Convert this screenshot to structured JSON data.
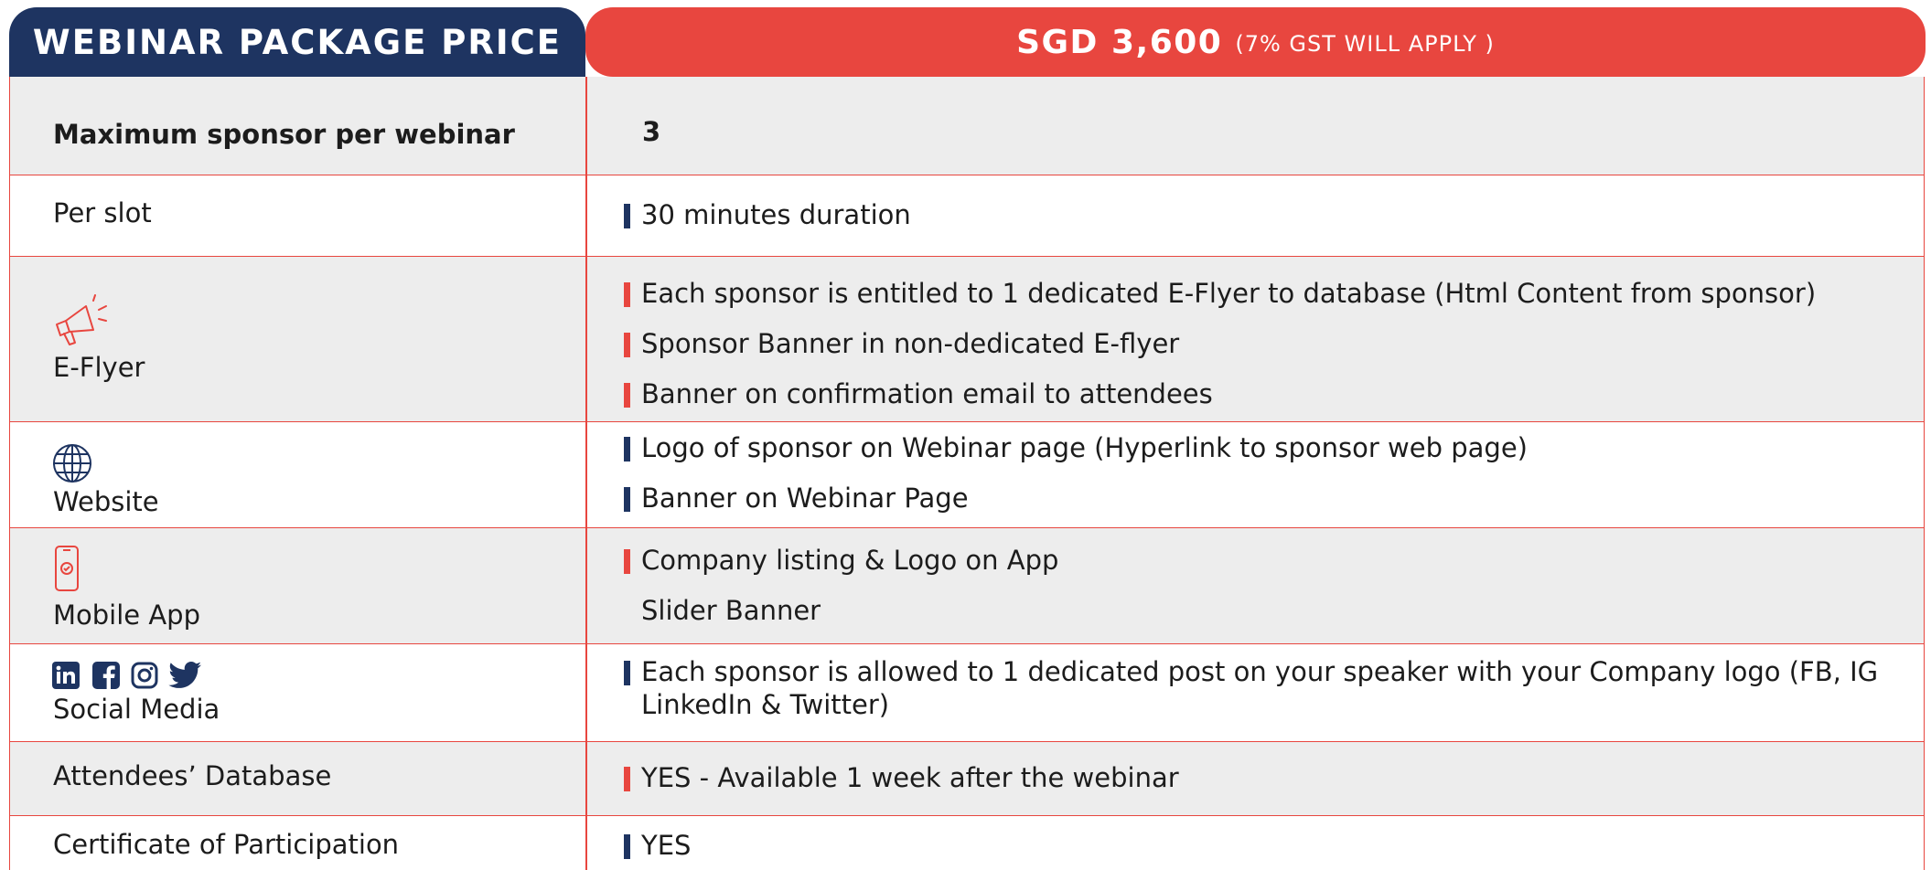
{
  "header": {
    "title": "WEBINAR PACKAGE PRICE",
    "price": "SGD 3,600",
    "gst_note": "(7% GST WILL APPLY )"
  },
  "rows": [
    {
      "label": "Maximum sponsor per webinar",
      "values": [
        "3"
      ]
    },
    {
      "label": "Per slot",
      "values": [
        "30 minutes duration"
      ]
    },
    {
      "label": "E-Flyer",
      "icon": "megaphone-icon",
      "values": [
        "Each sponsor is entitled to 1 dedicated E-Flyer to database (Html Content from sponsor)",
        "Sponsor Banner in non-dedicated E-flyer",
        "Banner on confirmation email to attendees"
      ]
    },
    {
      "label": "Website",
      "icon": "globe-icon",
      "values": [
        "Logo of sponsor on Webinar page (Hyperlink to sponsor web page)",
        "Banner on Webinar Page"
      ]
    },
    {
      "label": "Mobile App",
      "icon": "mobile-phone-icon",
      "values": [
        "Company listing & Logo on App",
        "Slider Banner"
      ]
    },
    {
      "label": "Social Media",
      "icons": [
        "linkedin-icon",
        "facebook-icon",
        "instagram-icon",
        "twitter-icon"
      ],
      "values": [
        "Each sponsor is allowed to 1 dedicated post on your speaker with your Company logo (FB, IG LinkedIn & Twitter)"
      ]
    },
    {
      "label": "Attendees’ Database",
      "values": [
        "YES - Available 1 week after the webinar"
      ]
    },
    {
      "label": "Certificate of Participation",
      "values": [
        "YES"
      ]
    }
  ],
  "colors": {
    "navy": "#1e3461",
    "red": "#e8463f",
    "gray_row": "#ededed"
  }
}
